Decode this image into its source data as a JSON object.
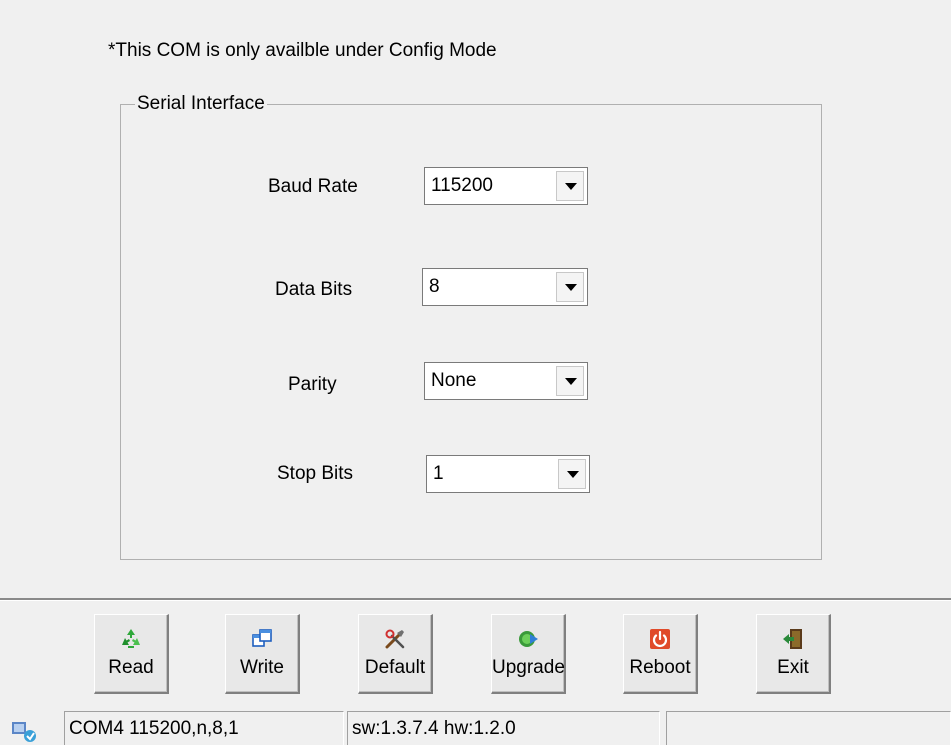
{
  "note": "*This COM is only availble under Config Mode",
  "serial_interface": {
    "title": "Serial Interface",
    "fields": [
      {
        "label": "Baud Rate",
        "value": "115200"
      },
      {
        "label": "Data Bits",
        "value": "8"
      },
      {
        "label": "Parity",
        "value": "None"
      },
      {
        "label": "Stop Bits",
        "value": "1"
      }
    ]
  },
  "toolbar": {
    "buttons": [
      {
        "label": "Read",
        "icon": "recycle-icon"
      },
      {
        "label": "Write",
        "icon": "copy-windows-icon"
      },
      {
        "label": "Default",
        "icon": "tools-icon"
      },
      {
        "label": "Upgrade",
        "icon": "upgrade-icon"
      },
      {
        "label": "Reboot",
        "icon": "power-icon"
      },
      {
        "label": "Exit",
        "icon": "exit-door-icon"
      }
    ]
  },
  "status_bar": {
    "port": "COM4 115200,n,8,1",
    "version": "sw:1.3.7.4 hw:1.2.0",
    "extra": ""
  }
}
